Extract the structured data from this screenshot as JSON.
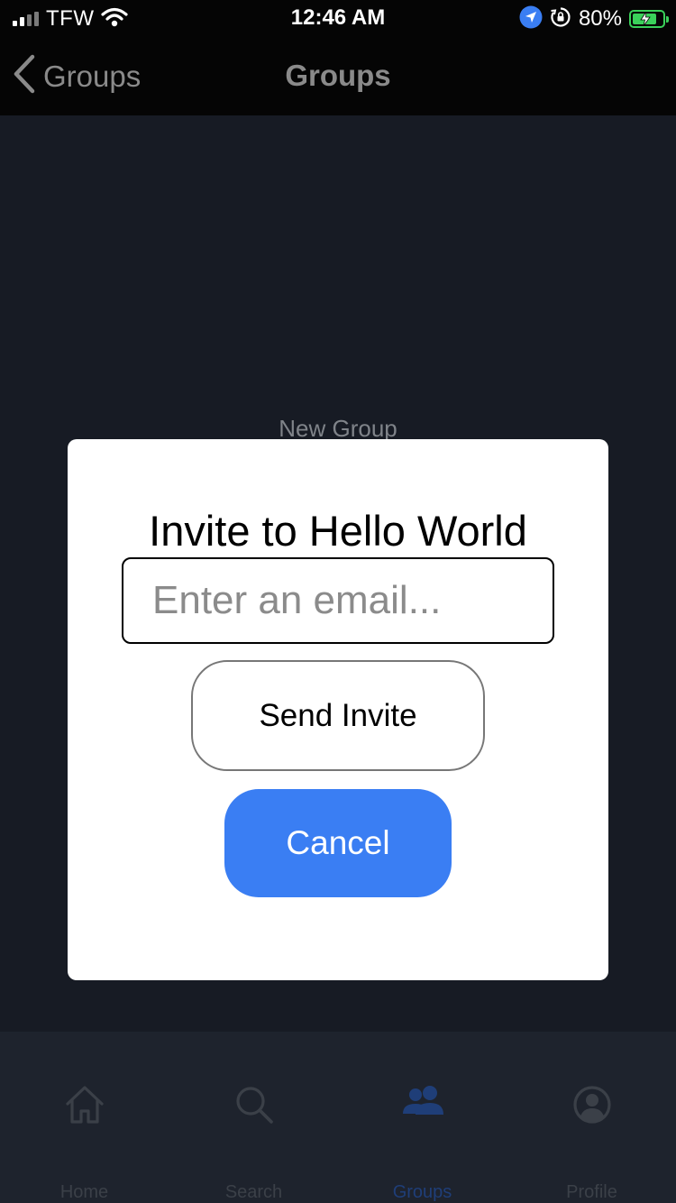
{
  "status_bar": {
    "carrier": "TFW",
    "time": "12:46 AM",
    "battery_percent": "80%",
    "signal_bars": 4,
    "signal_active": 2,
    "icons": [
      "signal-icon",
      "wifi-icon",
      "location-icon",
      "rotation-lock-icon",
      "battery-charging-icon"
    ]
  },
  "nav": {
    "back_label": "Groups",
    "title": "Groups"
  },
  "content": {
    "new_group_label": "New Group"
  },
  "modal": {
    "title": "Invite to Hello World",
    "email_placeholder": "Enter an email...",
    "email_value": "",
    "send_label": "Send Invite",
    "cancel_label": "Cancel"
  },
  "tabs": [
    {
      "label": "Home",
      "icon": "home-icon",
      "active": false
    },
    {
      "label": "Search",
      "icon": "search-icon",
      "active": false
    },
    {
      "label": "Groups",
      "icon": "groups-icon",
      "active": true
    },
    {
      "label": "Profile",
      "icon": "profile-icon",
      "active": false
    }
  ],
  "colors": {
    "accent": "#3a7ef3",
    "background": "#171b24",
    "tab_bar": "#1e232d",
    "active_tab": "#1f3e78",
    "battery": "#3ad15a"
  }
}
